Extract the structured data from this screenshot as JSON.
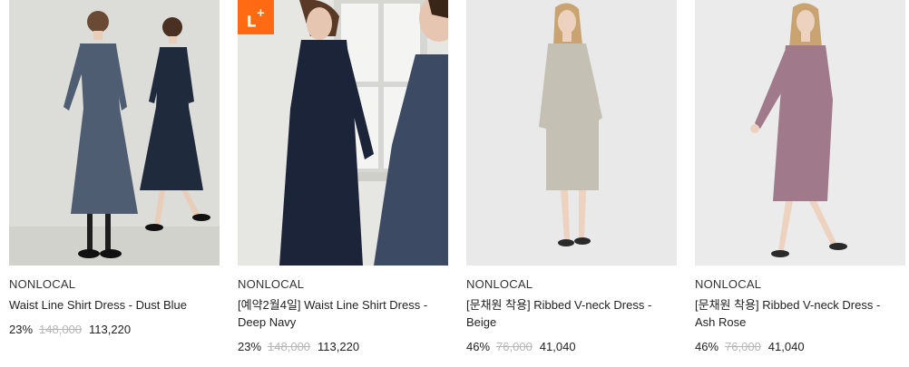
{
  "products": [
    {
      "brand": "NONLOCAL",
      "name": "Waist Line Shirt Dress - Dust Blue",
      "discount": "23%",
      "original_price": "148,000",
      "sale_price": "113,220",
      "badge": null,
      "colors": {
        "bg": "#dcdcd8",
        "dress": "#4f5d72",
        "dress2": "#1f2a3c"
      }
    },
    {
      "brand": "NONLOCAL",
      "name": "[예약2월4일] Waist Line Shirt Dress - Deep Navy",
      "discount": "23%",
      "original_price": "148,000",
      "sale_price": "113,220",
      "badge": {
        "letter": "L",
        "mark": "+"
      },
      "colors": {
        "bg": "#e6e6e2",
        "dress": "#1b2438",
        "dress2": "#3d4a63"
      }
    },
    {
      "brand": "NONLOCAL",
      "name": "[문채원 착용] Ribbed V-neck Dress - Beige",
      "discount": "46%",
      "original_price": "76,000",
      "sale_price": "41,040",
      "badge": null,
      "colors": {
        "bg": "#e9e9e9",
        "dress": "#c4c0b3",
        "dress2": "#c4c0b3"
      }
    },
    {
      "brand": "NONLOCAL",
      "name": "[문채원 착용] Ribbed V-neck Dress - Ash Rose",
      "discount": "46%",
      "original_price": "76,000",
      "sale_price": "41,040",
      "badge": null,
      "colors": {
        "bg": "#ebebeb",
        "dress": "#a07a8a",
        "dress2": "#a07a8a"
      }
    }
  ]
}
